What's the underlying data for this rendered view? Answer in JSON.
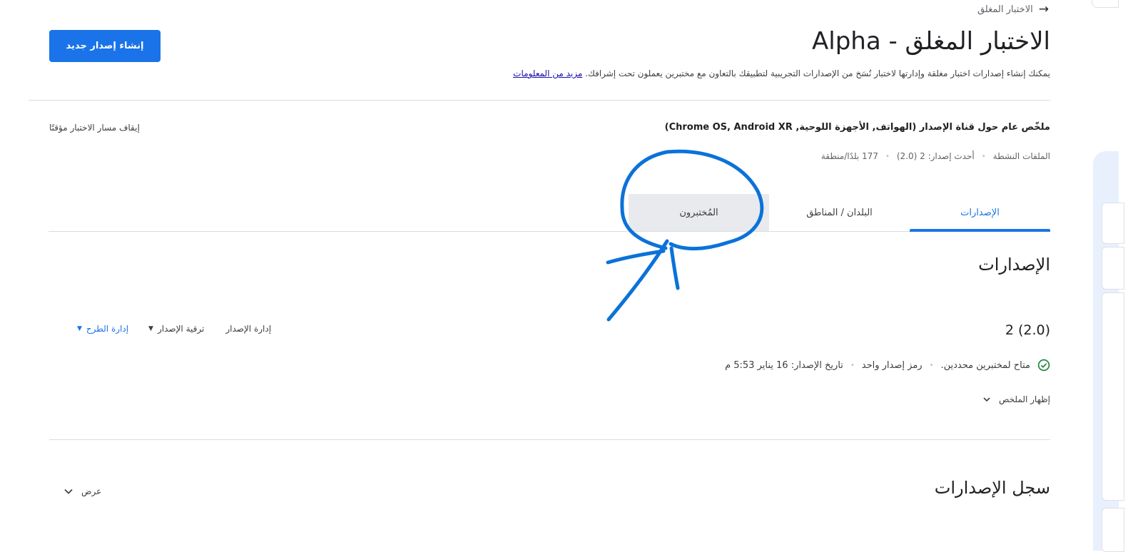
{
  "breadcrumb": {
    "arrow": "→",
    "label": "الاختبار المغلق"
  },
  "header": {
    "title": "الاختبار المغلق - Alpha",
    "create_button": "إنشاء إصدار جديد",
    "description": "يمكنك إنشاء إصدارات اختبار مغلقة وإدارتها لاختبار نُسَخ من الإصدارات التجريبية لتطبيقك بالتعاون مع مختبرين يعملون تحت إشرافك.",
    "learn_more": "مزيد من المعلومات"
  },
  "track": {
    "summary": "ملخّص عام حول قناة الإصدار (الهواتف, الأجهزة اللوحية, Chrome OS, Android XR)",
    "pause": "إيقاف مسار الاختبار مؤقتًا",
    "meta": [
      "الملفات النشطة",
      "أحدث إصدار: 2 (2.0)",
      "177 بلدًا/منطقة"
    ],
    "meta_separator": "•"
  },
  "tabs": [
    "الإصدارات",
    "البلدان / المناطق",
    "المُختبرون"
  ],
  "releases": {
    "heading": "الإصدارات",
    "release_name": "2 (2.0)",
    "actions": {
      "manage": "إدارة الإصدار",
      "promote": "ترقية الإصدار",
      "rollout": "إدارة الطرح"
    },
    "status": [
      "متاح لمختبرين محددين.",
      "رمز إصدار واحد",
      "تاريخ الإصدار: 16 يناير 5:53 م"
    ],
    "show_summary": "إظهار الملخص"
  },
  "history": {
    "heading": "سجل الإصدارات",
    "view": "عرض"
  },
  "icons": {
    "check": "check-circle-icon",
    "chevron": "chevron-down-icon",
    "dropdown": "dropdown-triangle-icon",
    "back": "arrow-icon"
  },
  "colors": {
    "accent": "#1a73e8",
    "success": "#188038",
    "annotation": "#0b72d9",
    "tab_hover": "#e8eaed",
    "side_panel": "#e8f0fe"
  }
}
